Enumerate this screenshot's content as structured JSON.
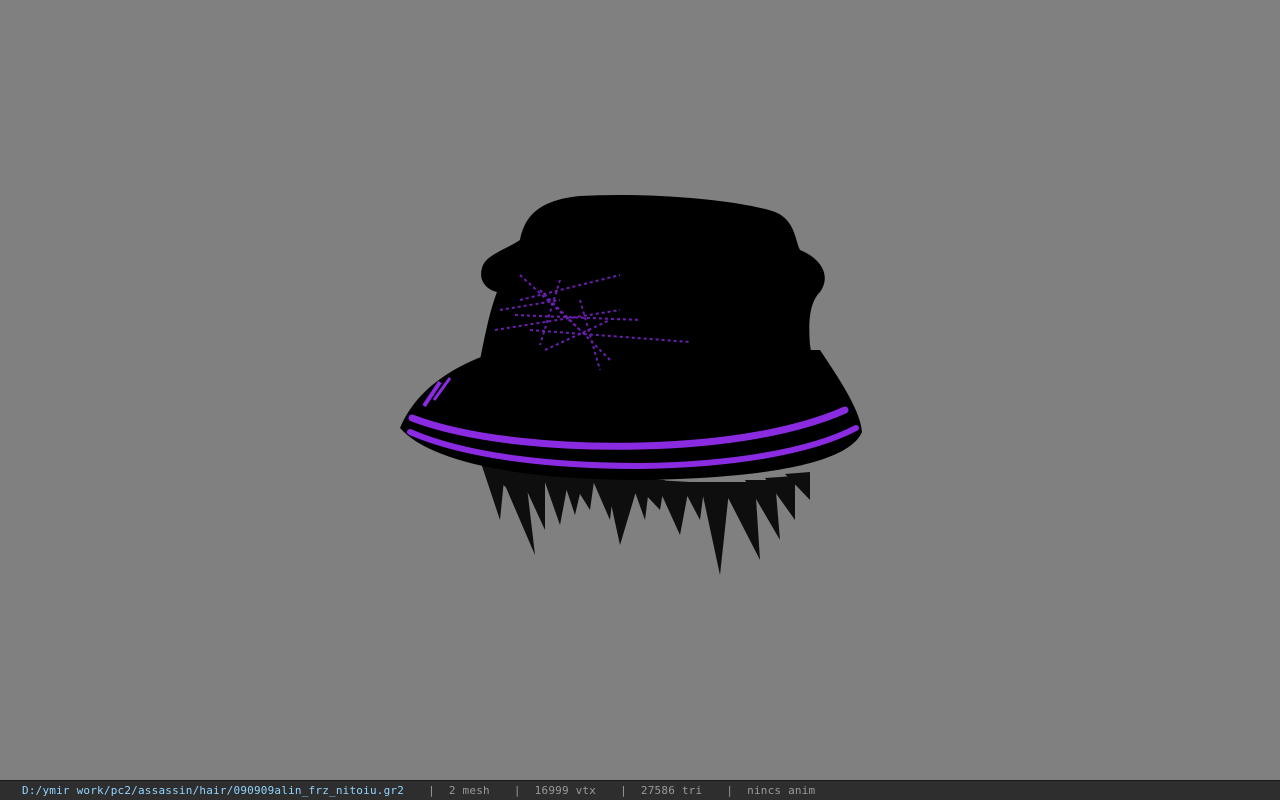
{
  "viewer": {
    "background_color": "#808080",
    "model": {
      "hat_color": "#000000",
      "stripe_color": "#8a2be2",
      "hair_color": "#111111"
    }
  },
  "status_bar": {
    "file_path": "D:/ymir work/pc2/assassin/hair/090909alin_frz_nitoiu.gr2",
    "separator": "|",
    "mesh_count": "2 mesh",
    "vertex_count": "16999 vtx",
    "triangle_count": "27586 tri",
    "animation": "nincs anim"
  }
}
